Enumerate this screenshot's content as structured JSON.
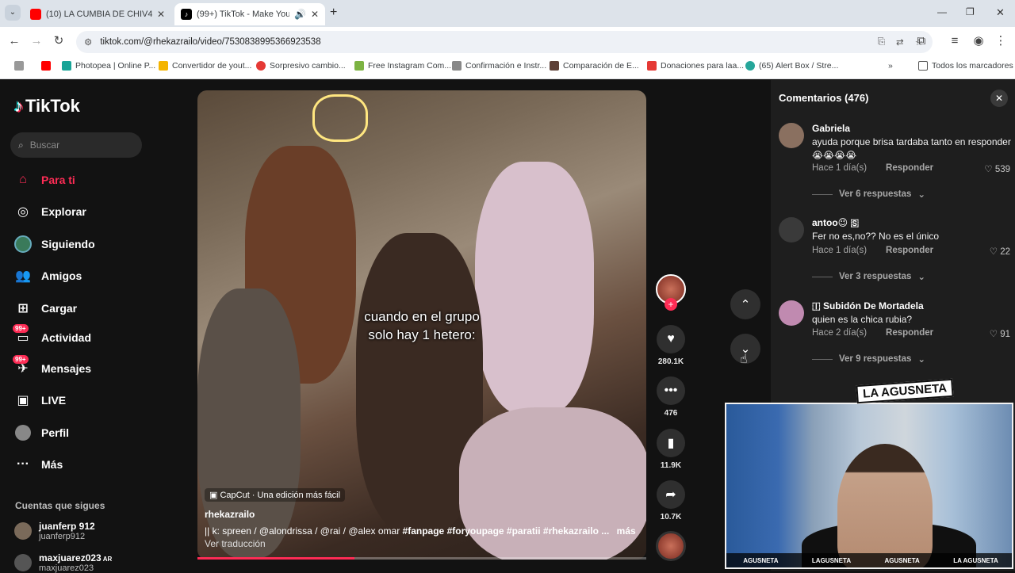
{
  "browser": {
    "tabs": [
      {
        "title": "(10) LA CUMBIA DE CHIV4S - M",
        "favicon_color": "#ff0000",
        "active": false
      },
      {
        "title": "(99+) TikTok - Make Your Da",
        "favicon_color": "#000000",
        "active": true
      }
    ],
    "url": "tiktok.com/@rhekazrailo/video/7530838995366923538",
    "bookmarks": [
      {
        "label": "",
        "color": "#ff0000"
      },
      {
        "label": "Photopea | Online P...",
        "color": "#18a497"
      },
      {
        "label": "Convertidor de yout...",
        "color": "#f4b400"
      },
      {
        "label": "Sorpresivo cambio...",
        "color": "#e53935"
      },
      {
        "label": "Free Instagram Com...",
        "color": "#7cb342"
      },
      {
        "label": "Confirmación e Instr...",
        "color": "#888888"
      },
      {
        "label": "Comparación de E...",
        "color": "#5d4037"
      },
      {
        "label": "Donaciones para laa...",
        "color": "#e53935"
      },
      {
        "label": "(65) Alert Box / Stre...",
        "color": "#26a69a"
      }
    ],
    "all_bookmarks": "Todos los marcadores"
  },
  "tiktok": {
    "logo": "TikTok",
    "search_placeholder": "Buscar",
    "nav": [
      {
        "label": "Para ti",
        "icon": "home-icon",
        "active": true
      },
      {
        "label": "Explorar",
        "icon": "compass-icon"
      },
      {
        "label": "Siguiendo",
        "icon": "following-avatar-icon"
      },
      {
        "label": "Amigos",
        "icon": "friends-icon"
      },
      {
        "label": "Cargar",
        "icon": "upload-icon"
      },
      {
        "label": "Actividad",
        "icon": "activity-icon",
        "badge": "99+"
      },
      {
        "label": "Mensajes",
        "icon": "messages-icon",
        "badge": "99+"
      },
      {
        "label": "LIVE",
        "icon": "live-icon"
      },
      {
        "label": "Perfil",
        "icon": "profile-icon"
      },
      {
        "label": "Más",
        "icon": "more-icon"
      }
    ],
    "following_title": "Cuentas que sigues",
    "following": [
      {
        "name": "juanferp 912",
        "handle": "juanferp912"
      },
      {
        "name": "maxjuarez023",
        "handle": "maxjuarez023",
        "suffix": "AR"
      }
    ]
  },
  "video": {
    "caption_line1": "cuando en el grupo",
    "caption_line2": "solo hay 1 hetero:",
    "capcut": "CapCut · Una edición más fácil",
    "author": "rhekazrailo",
    "desc_prefix": "|| k: spreen / @alondrissa / @rai / @alex omar",
    "tags": "#fanpage #foryoupage #paratii #rhekazrailo ...",
    "more": "más",
    "translate": "Ver traducción",
    "progress": 0.35,
    "likes": "280.1K",
    "comments": "476",
    "saves": "11.9K",
    "shares": "10.7K"
  },
  "comments": {
    "title": "Comentarios (476)",
    "items": [
      {
        "user": "Gabriela",
        "text": "ayuda porque brisa tardaba tanto en responder 😭😭😭😭",
        "time": "Hace 1 día(s)",
        "reply": "Responder",
        "likes": "539",
        "more": "Ver 6 respuestas",
        "avatar": "#8a7060"
      },
      {
        "user": "antoo😉 🇸",
        "text": "Fer no es,no?? No es el único",
        "time": "Hace 1 día(s)",
        "reply": "Responder",
        "likes": "22",
        "more": "Ver 3 respuestas",
        "avatar": "#3a3a3a"
      },
      {
        "user": "🇮 Subidón De Mortadela",
        "text": "quien es la chica rubia?",
        "time": "Hace 2 día(s)",
        "reply": "Responder",
        "likes": "91",
        "more": "Ver 9 respuestas",
        "avatar": "#c08ab0"
      }
    ]
  },
  "webcam": {
    "brand": "LA AGUSNETA",
    "footer": [
      "AGUSNETA",
      "LAGUSNETA",
      "AGUSNETA",
      "LA AGUSNETA"
    ]
  }
}
